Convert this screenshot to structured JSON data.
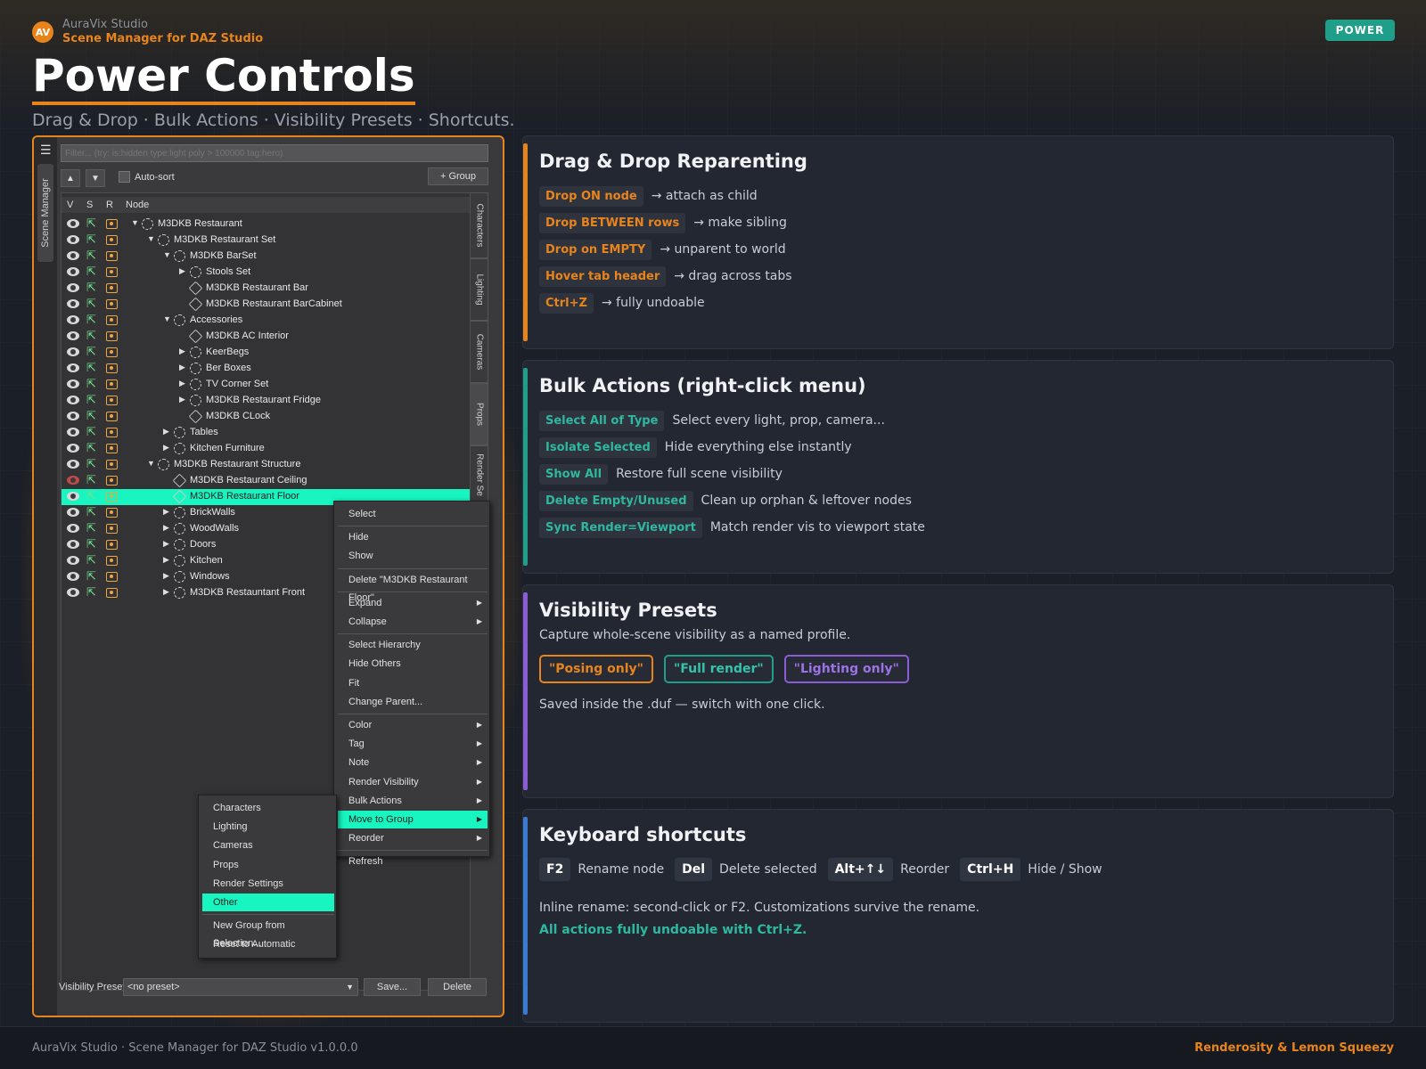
{
  "brand": {
    "logo": "AV",
    "name": "AuraVix Studio",
    "sub": "Scene Manager for DAZ Studio"
  },
  "badge": "POWER",
  "title": "Power Controls",
  "subtitle": "Drag & Drop · Bulk Actions · Visibility Presets · Shortcuts.",
  "footer": {
    "left": "AuraVix Studio · Scene Manager for DAZ Studio v1.0.0.0",
    "right": "Renderosity & Lemon Squeezy"
  },
  "colors": {
    "accent": "#e8841c",
    "teal": "#1f9e8a",
    "purple": "#8a5cd6",
    "blue": "#3a7bd5",
    "highlight": "#18f5c0"
  },
  "app": {
    "side_tab": "Scene Manager",
    "menu_icon": "menu-icon",
    "filter_placeholder": "Filter... (try: is:hidden type:light poly > 100000 tag:hero)",
    "up": "▲",
    "down": "▼",
    "autosort": "Auto-sort",
    "group_btn": "+ Group",
    "headers": {
      "v": "V",
      "s": "S",
      "r": "R",
      "node": "Node"
    },
    "vtabs": [
      "Characters",
      "Lighting",
      "Cameras",
      "Props",
      "Render Se"
    ],
    "rows": [
      {
        "label": "M3DKB Restaurant",
        "depth": 0,
        "arrow": "▼",
        "icon": "group"
      },
      {
        "label": "M3DKB Restaurant Set",
        "depth": 1,
        "arrow": "▼",
        "icon": "group"
      },
      {
        "label": "M3DKB BarSet",
        "depth": 2,
        "arrow": "▼",
        "icon": "group"
      },
      {
        "label": "Stools Set",
        "depth": 3,
        "arrow": "▶",
        "icon": "group"
      },
      {
        "label": "M3DKB Restaurant Bar",
        "depth": 3,
        "arrow": "",
        "icon": "mesh"
      },
      {
        "label": "M3DKB Restaurant BarCabinet",
        "depth": 3,
        "arrow": "",
        "icon": "mesh"
      },
      {
        "label": "Accessories",
        "depth": 2,
        "arrow": "▼",
        "icon": "group"
      },
      {
        "label": "M3DKB AC Interior",
        "depth": 3,
        "arrow": "",
        "icon": "mesh"
      },
      {
        "label": "KeerBegs",
        "depth": 3,
        "arrow": "▶",
        "icon": "group"
      },
      {
        "label": "Ber Boxes",
        "depth": 3,
        "arrow": "▶",
        "icon": "group"
      },
      {
        "label": "TV Corner Set",
        "depth": 3,
        "arrow": "▶",
        "icon": "group"
      },
      {
        "label": "M3DKB Restaurant Fridge",
        "depth": 3,
        "arrow": "▶",
        "icon": "group"
      },
      {
        "label": "M3DKB CLock",
        "depth": 3,
        "arrow": "",
        "icon": "mesh"
      },
      {
        "label": "Tables",
        "depth": 2,
        "arrow": "▶",
        "icon": "group"
      },
      {
        "label": "Kitchen Furniture",
        "depth": 2,
        "arrow": "▶",
        "icon": "group"
      },
      {
        "label": "M3DKB Restaurant Structure",
        "depth": 1,
        "arrow": "▼",
        "icon": "group"
      },
      {
        "label": "M3DKB Restaurant Ceiling",
        "depth": 2,
        "arrow": "",
        "icon": "mesh",
        "hidden": true
      },
      {
        "label": "M3DKB Restaurant Floor",
        "depth": 2,
        "arrow": "",
        "icon": "mesh",
        "selected": true
      },
      {
        "label": "BrickWalls",
        "depth": 2,
        "arrow": "▶",
        "icon": "group"
      },
      {
        "label": "WoodWalls",
        "depth": 2,
        "arrow": "▶",
        "icon": "group"
      },
      {
        "label": "Doors",
        "depth": 2,
        "arrow": "▶",
        "icon": "group"
      },
      {
        "label": "Kitchen",
        "depth": 2,
        "arrow": "▶",
        "icon": "group"
      },
      {
        "label": "Windows",
        "depth": 2,
        "arrow": "▶",
        "icon": "group"
      },
      {
        "label": "M3DKB Restauntant Front",
        "depth": 2,
        "arrow": "▶",
        "icon": "group"
      }
    ],
    "context_menu": [
      {
        "label": "Select"
      },
      {
        "sep": true
      },
      {
        "label": "Hide"
      },
      {
        "label": "Show"
      },
      {
        "sep": true
      },
      {
        "label": "Delete \"M3DKB Restaurant Floor\""
      },
      {
        "sep": true
      },
      {
        "label": "Expand",
        "sub": true
      },
      {
        "label": "Collapse",
        "sub": true
      },
      {
        "sep": true
      },
      {
        "label": "Select Hierarchy"
      },
      {
        "label": "Hide Others"
      },
      {
        "label": "Fit"
      },
      {
        "label": "Change Parent..."
      },
      {
        "sep": true
      },
      {
        "label": "Color",
        "sub": true
      },
      {
        "label": "Tag",
        "sub": true
      },
      {
        "label": "Note",
        "sub": true
      },
      {
        "label": "Render Visibility",
        "sub": true
      },
      {
        "label": "Bulk Actions",
        "sub": true
      },
      {
        "label": "Move to Group",
        "sub": true,
        "highlight": true
      },
      {
        "label": "Reorder",
        "sub": true
      },
      {
        "sep": true
      },
      {
        "label": "Refresh"
      }
    ],
    "submenu": [
      {
        "label": "Characters"
      },
      {
        "label": "Lighting"
      },
      {
        "label": "Cameras"
      },
      {
        "label": "Props"
      },
      {
        "label": "Render Settings"
      },
      {
        "label": "Other",
        "highlight": true
      },
      {
        "sep": true
      },
      {
        "label": "New Group from Selection..."
      },
      {
        "label": "Reset to Automatic"
      }
    ],
    "preset_label": "Visibility Preset:",
    "preset_value": "<no preset>",
    "save": "Save...",
    "delete": "Delete"
  },
  "panels": {
    "drag": {
      "title": "Drag & Drop Reparenting",
      "items": [
        {
          "key": "Drop ON node",
          "desc": "→ attach as child"
        },
        {
          "key": "Drop BETWEEN rows",
          "desc": "→ make sibling"
        },
        {
          "key": "Drop on EMPTY",
          "desc": "→ unparent to world"
        },
        {
          "key": "Hover tab header",
          "desc": "→ drag across tabs"
        },
        {
          "key": "Ctrl+Z",
          "desc": "→ fully undoable"
        }
      ]
    },
    "bulk": {
      "title": "Bulk Actions  (right-click menu)",
      "items": [
        {
          "key": "Select All of Type",
          "desc": "Select every light, prop, camera..."
        },
        {
          "key": "Isolate Selected",
          "desc": "Hide everything else instantly"
        },
        {
          "key": "Show All",
          "desc": "Restore full scene visibility"
        },
        {
          "key": "Delete Empty/Unused",
          "desc": "Clean up orphan & leftover nodes"
        },
        {
          "key": "Sync Render=Viewport",
          "desc": "Match render vis to viewport state"
        }
      ]
    },
    "vis": {
      "title": "Visibility Presets",
      "desc1": "Capture whole-scene visibility as a named profile.",
      "presets": [
        "\"Posing only\"",
        "\"Full render\"",
        "\"Lighting only\""
      ],
      "desc2": "Saved inside the .duf — switch with one click."
    },
    "keys": {
      "title": "Keyboard shortcuts",
      "items": [
        {
          "key": "F2",
          "desc": "Rename node"
        },
        {
          "key": "Del",
          "desc": "Delete selected"
        },
        {
          "key": "Alt+↑↓",
          "desc": "Reorder"
        },
        {
          "key": "Ctrl+H",
          "desc": "Hide / Show"
        }
      ],
      "note": "Inline rename: second-click or F2. Customizations survive the rename.",
      "undo": "All actions fully undoable with Ctrl+Z."
    }
  }
}
